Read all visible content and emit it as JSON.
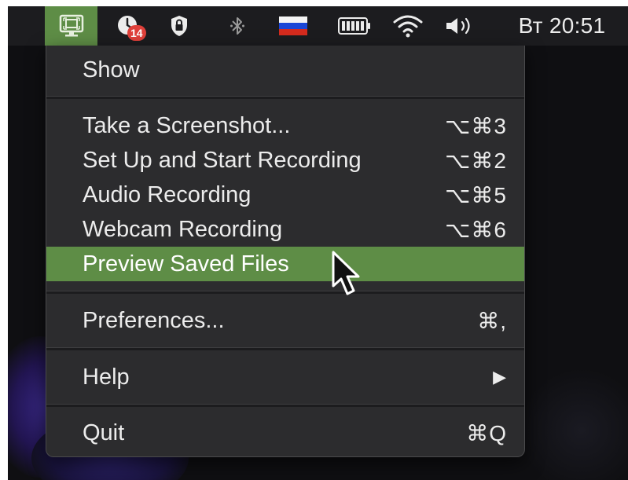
{
  "menubar": {
    "badge_count": "14",
    "clock": "Вт 20:51",
    "icons": [
      "screen-recorder-icon",
      "notification-icon",
      "shield-lock-icon",
      "bluetooth-icon",
      "russian-flag-icon",
      "battery-icon",
      "wifi-icon",
      "volume-icon"
    ]
  },
  "menu": {
    "show": "Show",
    "take_screenshot": {
      "label": "Take a Screenshot...",
      "shortcut": "⌥⌘3"
    },
    "start_recording": {
      "label": "Set Up and Start Recording",
      "shortcut": "⌥⌘2"
    },
    "audio_recording": {
      "label": "Audio Recording",
      "shortcut": "⌥⌘5"
    },
    "webcam_recording": {
      "label": "Webcam Recording",
      "shortcut": "⌥⌘6"
    },
    "preview_saved": {
      "label": "Preview Saved Files",
      "highlighted": true
    },
    "preferences": {
      "label": "Preferences...",
      "shortcut": "⌘,"
    },
    "help": {
      "label": "Help",
      "submenu_arrow": "▶"
    },
    "quit": {
      "label": "Quit",
      "shortcut": "⌘Q"
    }
  },
  "colors": {
    "accent": "#5e8d46",
    "menu_bg": "#2c2c2e",
    "menubar_bg": "#1c1c1f",
    "badge": "#e0403a"
  }
}
